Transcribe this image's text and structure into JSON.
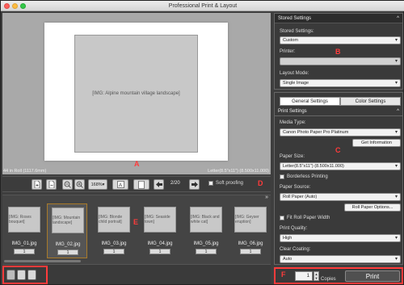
{
  "window": {
    "title": "Professional Print & Layout"
  },
  "labels": {
    "A": "A",
    "B": "B",
    "C": "C",
    "D": "D",
    "E": "E",
    "F": "F"
  },
  "preview": {
    "image": "[IMG: Alpine mountain village landscape]",
    "media_info": "44 in Roll (1117.6mm)",
    "page_info": "Letter(8.5\"x11\") (8.500x11.000)"
  },
  "toolbar": {
    "zoom": "168%",
    "page": "2/20",
    "soft_proofing": "Soft proofing"
  },
  "thumbnails": [
    {
      "name": "IMG_01.jpg",
      "count": "1",
      "img": "[IMG: Roses bouquet]"
    },
    {
      "name": "IMG_02.jpg",
      "count": "1",
      "img": "[IMG: Mountain landscape]"
    },
    {
      "name": "IMG_03.jpg",
      "count": "1",
      "img": "[IMG: Blonde child portrait]"
    },
    {
      "name": "IMG_04.jpg",
      "count": "1",
      "img": "[IMG: Seaside town]"
    },
    {
      "name": "IMG_05.jpg",
      "count": "1",
      "img": "[IMG: Black and white cat]"
    },
    {
      "name": "IMG_06.jpg",
      "count": "1",
      "img": "[IMG: Geyser eruption]"
    }
  ],
  "stored": {
    "header": "Stored Settings",
    "stored_label": "Stored Settings:",
    "stored_value": "Custom",
    "printer_label": "Printer:",
    "printer_value": "",
    "layout_label": "Layout Mode:",
    "layout_value": "Single Image"
  },
  "settings": {
    "tab_general": "General Settings",
    "tab_color": "Color Settings",
    "header": "Print Settings",
    "media_label": "Media Type:",
    "media_value": "Canon Photo Paper Pro Platinum",
    "get_info": "Get Information",
    "paper_size_label": "Paper Size:",
    "paper_size_value": "Letter(8.5\"x11\") (8.500x11.000)",
    "borderless": "Borderless Printing",
    "source_label": "Paper Source:",
    "source_value": "Roll Paper (Auto)",
    "roll_options": "Roll Paper Options...",
    "fit_roll": "Fit Roll Paper Width",
    "quality_label": "Print Quality:",
    "quality_value": "High",
    "coating_label": "Clear Coating:",
    "coating_value": "Auto"
  },
  "print": {
    "copies_value": "1",
    "copies_label": "Copies",
    "button": "Print"
  },
  "colors": {
    "accent": "#ff3b3b",
    "selection": "#a87a2a"
  }
}
